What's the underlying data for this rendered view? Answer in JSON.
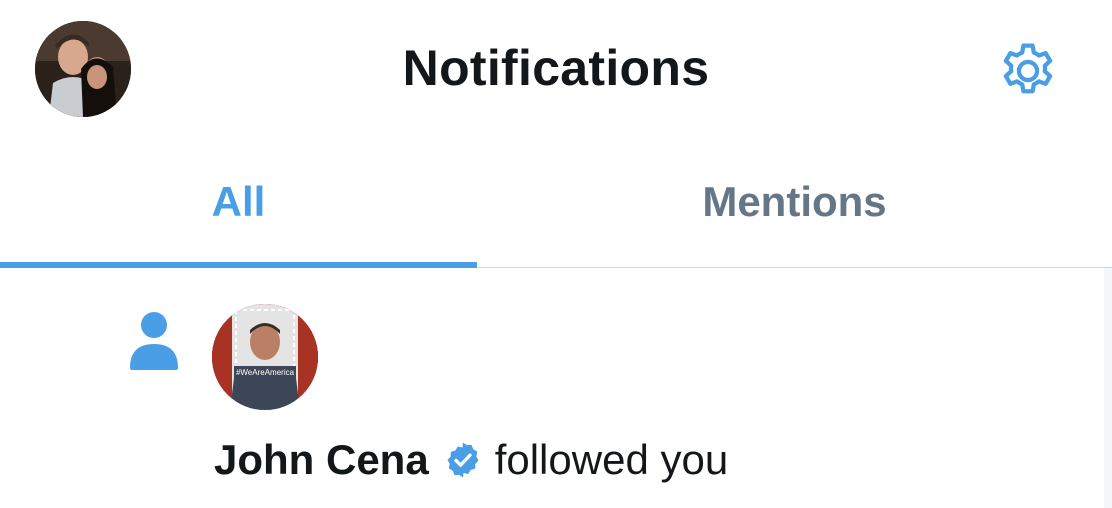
{
  "header": {
    "title": "Notifications",
    "profile_icon": "user-avatar",
    "settings_icon": "gear-icon"
  },
  "tabs": [
    {
      "label": "All",
      "active": true
    },
    {
      "label": "Mentions",
      "active": false
    }
  ],
  "notifications": [
    {
      "type_icon": "person-icon",
      "user": "John Cena",
      "verified": true,
      "verified_icon": "verified-badge-icon",
      "action": "followed you",
      "avatar_caption": "#WeAreAmerica"
    }
  ],
  "colors": {
    "accent": "#4a9ee6",
    "text_primary": "#14171a",
    "text_secondary": "#657786",
    "divider": "#d4d8dc"
  }
}
